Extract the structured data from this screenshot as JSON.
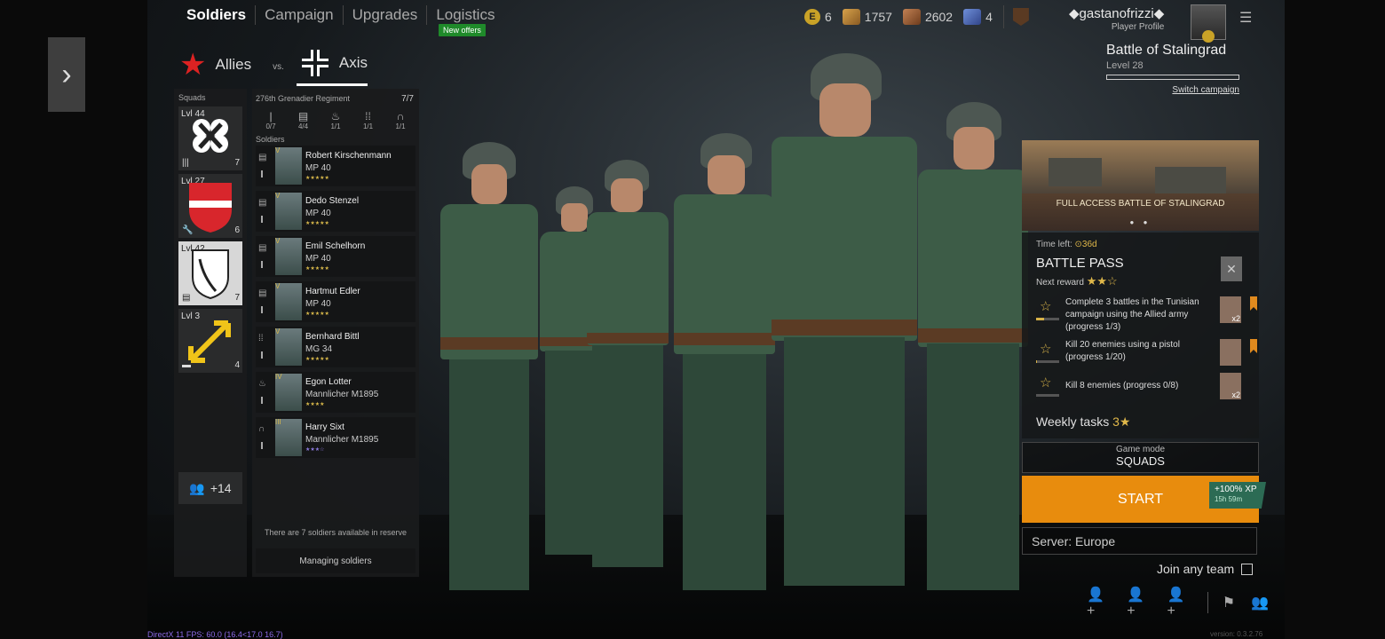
{
  "nav": {
    "tabs": [
      "Soldiers",
      "Campaign",
      "Upgrades",
      "Logistics"
    ],
    "new_offers": "New offers"
  },
  "currencies": [
    "6",
    "1757",
    "2602",
    "4"
  ],
  "user": {
    "name": "◆gastanofrizzi◆",
    "subtitle": "Player Profile"
  },
  "campaign": {
    "title": "Battle of Stalingrad",
    "level": "Level 28",
    "switch": "Switch campaign"
  },
  "factions": {
    "allies": "Allies",
    "vs": "vs.",
    "axis": "Axis"
  },
  "squads": {
    "header": "Squads",
    "items": [
      {
        "level": "Lvl 44",
        "count": "7"
      },
      {
        "level": "Lvl 27",
        "count": "6"
      },
      {
        "level": "Lvl 42",
        "count": "7"
      },
      {
        "level": "Lvl 3",
        "count": "4"
      }
    ],
    "more": "+14"
  },
  "regiment": {
    "name": "276th Grenadier Regiment",
    "count": "7/7",
    "slots": [
      "0/7",
      "4/4",
      "1/1",
      "1/1",
      "1/1"
    ],
    "soldiers_label": "Soldiers"
  },
  "soldiers": [
    {
      "rank": "V",
      "name": "Robert Kirschenmann",
      "weapon": "MP 40",
      "stars": "★★★★★"
    },
    {
      "rank": "V",
      "name": "Dedo Stenzel",
      "weapon": "MP 40",
      "stars": "★★★★★"
    },
    {
      "rank": "V",
      "name": "Emil Schelhorn",
      "weapon": "MP 40",
      "stars": "★★★★★"
    },
    {
      "rank": "V",
      "name": "Hartmut Edler",
      "weapon": "MP 40",
      "stars": "★★★★★"
    },
    {
      "rank": "V",
      "name": "Bernhard Bittl",
      "weapon": "MG 34",
      "stars": "★★★★★"
    },
    {
      "rank": "IV",
      "name": "Egon Lotter",
      "weapon": "Mannlicher M1895",
      "stars": "★★★★"
    },
    {
      "rank": "III",
      "name": "Harry Sixt",
      "weapon": "Mannlicher M1895",
      "stars": "★★★☆"
    }
  ],
  "reserve_text": "There are 7 soldiers available in reserve",
  "manage_label": "Managing soldiers",
  "banner": {
    "caption": "FULL ACCESS BATTLE OF STALINGRAD",
    "dots": "● ●"
  },
  "battle_pass": {
    "time_label": "Time left:",
    "time_value": "36d",
    "title": "BATTLE PASS",
    "next_reward": "Next reward",
    "stars": "★★☆",
    "tasks": [
      {
        "text": "Complete 3 battles in the Tunisian campaign using the Allied army (progress 1/3)",
        "reward": "x2",
        "progress": 0.33
      },
      {
        "text": "Kill 20 enemies using a pistol (progress 1/20)",
        "reward": "",
        "progress": 0.05
      },
      {
        "text": "Kill 8 enemies (progress 0/8)",
        "reward": "x2",
        "progress": 0
      }
    ],
    "weekly_label": "Weekly tasks",
    "weekly_value": "3★"
  },
  "game_mode": {
    "label": "Game mode",
    "value": "SQUADS"
  },
  "start": {
    "label": "START",
    "xp": "+100% XP",
    "xp_time": "15h 59m"
  },
  "server": "Server: Europe",
  "join_any_team": "Join any team",
  "fps": "DirectX 11 FPS: 60.0 (16.4<17.0 16.7)",
  "version": "version: 0.3.2.76",
  "colors": {
    "accent": "#e88c0d",
    "xp": "#2c6b54",
    "gold": "#d7b248"
  }
}
